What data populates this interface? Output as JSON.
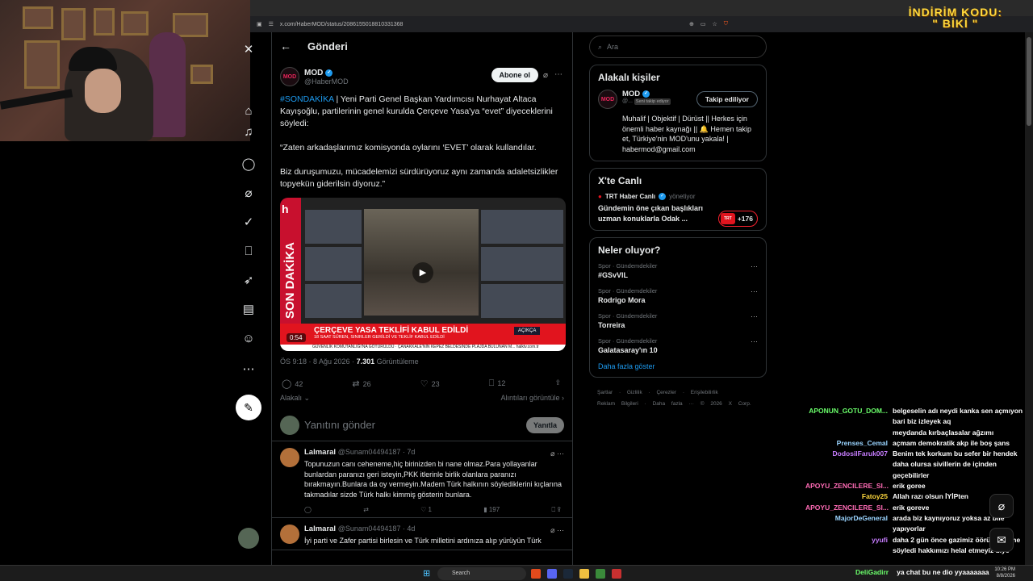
{
  "promo": {
    "line1": "İNDİRİM KODU:",
    "line2": "\" BİKİ \""
  },
  "browser": {
    "url": "x.com/HaberMOD/status/2086155018810331368"
  },
  "header": {
    "title": "Gönderi"
  },
  "post": {
    "author_name": "MOD",
    "author_handle": "@HaberMOD",
    "subscribe_label": "Abone ol",
    "hashtag": "#SONDAKİKA",
    "text1": " | Yeni Parti Genel Başkan Yardımcısı Nurhayat Altaca Kayışoğlu, partilerinin genel kurulda Çerçeve Yasa'ya “evet” diyeceklerini söyledi:",
    "text2": "“Zaten arkadaşlarımız komisyonda oylarını ‘EVET’ olarak kullandılar.",
    "text3": "Biz duruşumuzu, mücadelemizi sürdürüyoruz aynı zamanda adaletsizlikler topyekün giderilsin diyoruz.”",
    "media": {
      "side_text": "SON DAKİKA",
      "banner": "ÇERÇEVE YASA TEKLİFİ KABUL EDİLDİ",
      "subbanner": "18 SAAT SÜREN, SINIRLER GERİLDİ VE TEKLİF KABUL EDİLDİ",
      "ticker": "GÜVENLİK KOMUTANLIĞI'NA GÖTÜRÜLDÜ · ÇANAKKALE'NİN KEPEZ BELDESİNDE PLAJDA BULUNAN M... halktv.com.tr",
      "duration": "0:54",
      "live_label": "AÇIKÇA",
      "channel_tag": "CANLI",
      "small_time": "20:20",
      "logo": "h"
    },
    "time": "ÖS 9:18 · 8 Ağu 2026 · ",
    "views": "7.301",
    "views_label": " Görüntüleme",
    "replies": "42",
    "reposts": "26",
    "likes": "23",
    "bookmarks": "12",
    "related_label": "Alakalı",
    "quotes_label": "Alıntıları görüntüle"
  },
  "reply_box": {
    "placeholder": "Yanıtını gönder",
    "button": "Yanıtla"
  },
  "comments": [
    {
      "name": "Lalmaral",
      "handle": "@Sunam04494187 · 7d",
      "body": "Topunuzun canı ceheneme,hiç birinizden bi nane olmaz.Para yollayanlar bunlardan paranızı geri isteyin,PKK itlerinle birlik olanlara paranızı bırakmayın.Bunlara da oy vermeyin.Madem Türk halkının söylediklerini kıçlarına takmadılar sizde Türk halkı kimmiş gösterin bunlara.",
      "likes": "1",
      "views": "197"
    },
    {
      "name": "Lalmaral",
      "handle": "@Sunam04494187 · 4d",
      "body": "İyi parti ve Zafer partisi birlesin ve Türk milletini ardınıza alıp yürüyün Türk"
    }
  ],
  "right": {
    "search_placeholder": "Ara",
    "related_title": "Alakalı kişiler",
    "person_name": "MOD",
    "person_handle": "@...",
    "person_tag": "Seni takip ediyor",
    "follow_label": "Takip ediliyor",
    "person_bio": "Muhalif | Objektif | Dürüst || Herkes için önemli haber kaynağı || 🔔 Hemen takip et, Türkiye'nin MOD'unu yakala! | habermod@gmail.com",
    "live_title": "X'te Canlı",
    "live_channel": "TRT Haber Canlı",
    "live_role": "yönetiyor",
    "live_desc": "Gündemin öne çıkan başlıkları uzman konuklarla Odak ...",
    "live_count": "+176",
    "trends_title": "Neler oluyor?",
    "trends": [
      {
        "cat": "Spor · Gündemdekiler",
        "name": "#GSvVIL"
      },
      {
        "cat": "Spor · Gündemdekiler",
        "name": "Rodrigo Mora"
      },
      {
        "cat": "Spor · Gündemdekiler",
        "name": "Torreira"
      },
      {
        "cat": "Spor · Gündemdekiler",
        "name": "Galatasaray'ın 10"
      }
    ],
    "show_more": "Daha fazla göster",
    "footer_line1": "Şartlar · Gizlilik · Çerezler · Erişilebilirlik",
    "footer_line2": "Reklam Bilgileri · Daha fazla ··· © 2026 X Corp."
  },
  "chat": [
    {
      "user": "APONUN_GOTU_DOM...",
      "color": "#6bff6b",
      "text": "belgeselin adı neydi kanka sen açmıyon bari biz izleyek aq"
    },
    {
      "user": "",
      "color": "#fff",
      "text": "meydanda kırbaçlasalar ağzımı"
    },
    {
      "user": "Prenses_Cemal",
      "color": "#9ad4ff",
      "text": "açmam demokratik akp ile boş şans"
    },
    {
      "user": "DodosilFaruk007",
      "color": "#c77dff",
      "text": "Benim tek korkum bu sefer bir hendek daha olursa sivillerin de içinden geçebilirler"
    },
    {
      "user": "APOYU_ZENCILERE_SI...",
      "color": "#ff6bb5",
      "text": "erik goree"
    },
    {
      "user": "Fatoy25",
      "color": "#ffd93d",
      "text": "Allah razı olsun İYİPten"
    },
    {
      "user": "APOYU_ZENCILERE_SI...",
      "color": "#ff6bb5",
      "text": "erik goreve"
    },
    {
      "user": "MajorDeGeneral",
      "color": "#9ad4ff",
      "text": "arada biz kaynıyoruz yoksa az bile yapıyorlar"
    },
    {
      "user": "yyufi",
      "color": "#c77dff",
      "text": "daha 2 gün önce gazimiz öörün yüzüne söyledi hakkımızı helal etmeyiz diye"
    }
  ],
  "taskbar": {
    "search": "Search",
    "overlay_user": "DeliGadirr",
    "overlay_text": "ya chat bu ne dio yyaaaaaaa",
    "time": "10:26 PM",
    "date": "8/8/2026"
  }
}
